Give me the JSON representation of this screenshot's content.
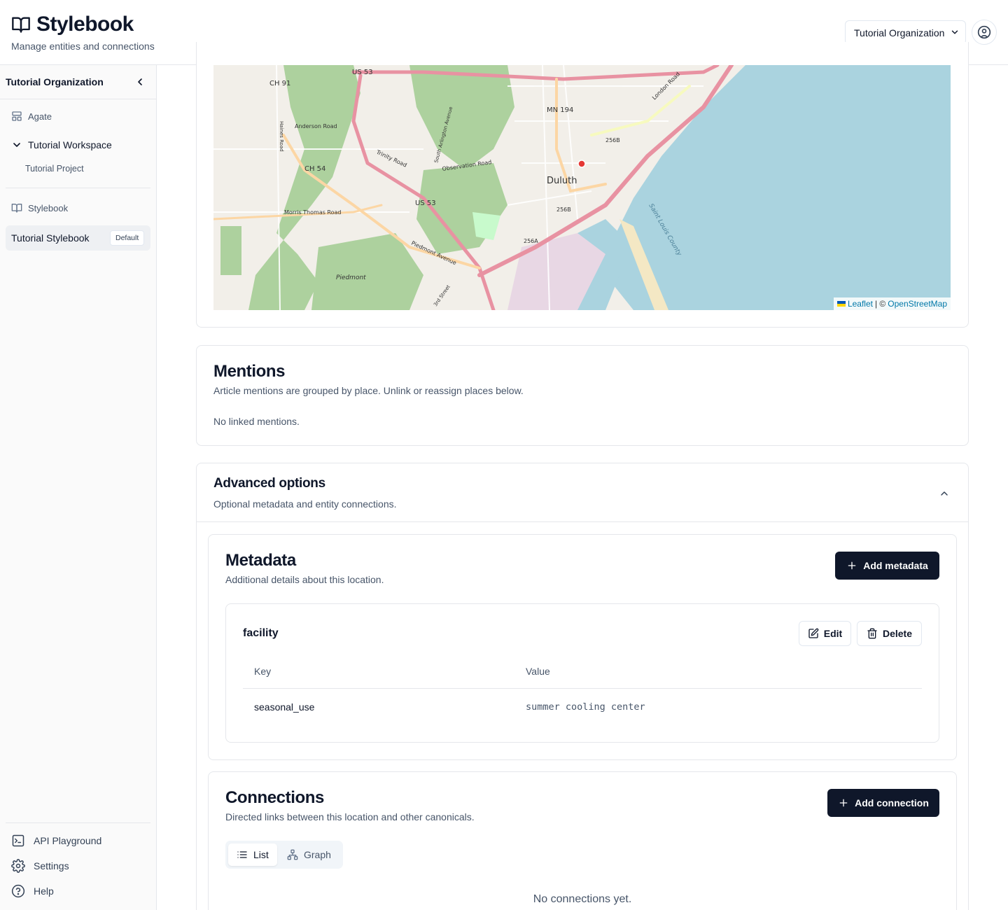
{
  "header": {
    "app_title": "Stylebook",
    "tagline": "Manage entities and connections",
    "org_selector": "Tutorial Organization"
  },
  "sidebar": {
    "org_name": "Tutorial Organization",
    "sections": [
      {
        "label": "Agate",
        "icon": "layout-icon"
      },
      {
        "label": "Tutorial Workspace",
        "icon": "chevron-down-icon"
      },
      {
        "label": "Tutorial Project"
      },
      {
        "label": "Stylebook",
        "icon": "book-icon"
      }
    ],
    "active_item": {
      "label": "Tutorial Stylebook",
      "badge": "Default"
    },
    "footer": [
      {
        "label": "API Playground",
        "icon": "terminal-icon"
      },
      {
        "label": "Settings",
        "icon": "gear-icon"
      },
      {
        "label": "Help",
        "icon": "help-circle-icon"
      }
    ]
  },
  "map": {
    "city_label": "Duluth",
    "road_labels": [
      "US 53",
      "CH 91",
      "Anderson Road",
      "Trinity Road",
      "CH 54",
      "Morris Thomas Road",
      "Observation Road",
      "MN 194",
      "Piedmont Avenue",
      "Piedmont",
      "256B",
      "256A",
      "London Road",
      "Saint Louis County",
      "Haines Road",
      "3rd Street",
      "South Arlington Avenue"
    ],
    "attribution_leaflet": "Leaflet",
    "attribution_sep": "| ©",
    "attribution_osm": "OpenStreetMap",
    "colors": {
      "water": "#aad3df",
      "park": "#add19e",
      "land": "#f2efe9",
      "primary_road": "#e892a2",
      "marker": "#e53935"
    }
  },
  "mentions": {
    "title": "Mentions",
    "subtitle": "Article mentions are grouped by place. Unlink or reassign places below.",
    "empty_text": "No linked mentions."
  },
  "advanced": {
    "title": "Advanced options",
    "subtitle": "Optional metadata and entity connections."
  },
  "metadata": {
    "title": "Metadata",
    "subtitle": "Additional details about this location.",
    "add_label": "Add metadata",
    "group": {
      "name": "facility",
      "edit_label": "Edit",
      "delete_label": "Delete",
      "columns": [
        "Key",
        "Value"
      ],
      "rows": [
        {
          "key": "seasonal_use",
          "value": "summer cooling center"
        }
      ]
    }
  },
  "connections": {
    "title": "Connections",
    "subtitle": "Directed links between this location and other canonicals.",
    "add_label": "Add connection",
    "tabs": [
      {
        "label": "List",
        "active": true
      },
      {
        "label": "Graph",
        "active": false
      }
    ],
    "empty_text": "No connections yet."
  }
}
